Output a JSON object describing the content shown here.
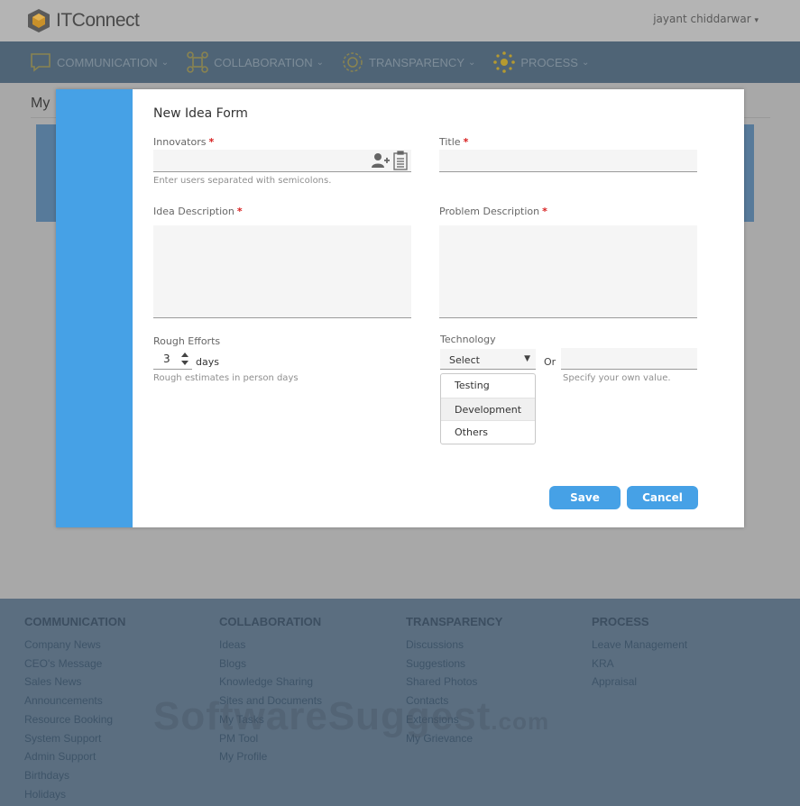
{
  "app": {
    "name": "ITConnect",
    "user": "jayant chiddarwar"
  },
  "nav": [
    {
      "label": "COMMUNICATION",
      "icon": "chat-icon"
    },
    {
      "label": "COLLABORATION",
      "icon": "nodes-icon"
    },
    {
      "label": "TRANSPARENCY",
      "icon": "gear-ring-icon"
    },
    {
      "label": "PROCESS",
      "icon": "dots-ring-icon"
    }
  ],
  "page": {
    "heading": "My"
  },
  "form": {
    "title": "New Idea Form",
    "innovators": {
      "label": "Innovators",
      "value": "",
      "hint": "Enter users separated with semicolons."
    },
    "title_field": {
      "label": "Title",
      "value": ""
    },
    "idea_description": {
      "label": "Idea Description",
      "value": ""
    },
    "problem_description": {
      "label": "Problem Description",
      "value": ""
    },
    "rough_efforts": {
      "label": "Rough Efforts",
      "value": "3",
      "unit": "days",
      "hint": "Rough estimates in person days"
    },
    "technology": {
      "label": "Technology",
      "selected": "Select",
      "or_label": "Or",
      "own_value_hint": "Specify your own value.",
      "options": [
        "Testing",
        "Development",
        "Others"
      ],
      "highlighted_option": "Development"
    },
    "save_label": "Save",
    "cancel_label": "Cancel"
  },
  "footer": {
    "columns": [
      {
        "heading": "COMMUNICATION",
        "links": [
          "Company News",
          "CEO's Message",
          "Sales News",
          "Announcements",
          "Resource Booking",
          "System Support",
          "Admin Support",
          "Birthdays",
          "Holidays"
        ]
      },
      {
        "heading": "COLLABORATION",
        "links": [
          "Ideas",
          "Blogs",
          "Knowledge Sharing",
          "Sites and Documents",
          "My Tasks",
          "PM Tool",
          "My Profile"
        ]
      },
      {
        "heading": "TRANSPARENCY",
        "links": [
          "Discussions",
          "Suggestions",
          "Shared Photos",
          "Contacts",
          "Extensions",
          "My Grievance"
        ]
      },
      {
        "heading": "PROCESS",
        "links": [
          "Leave Management",
          "KRA",
          "Appraisal"
        ]
      }
    ]
  },
  "watermark": {
    "main": "SoftwareSuggest",
    "suffix": ".com"
  }
}
